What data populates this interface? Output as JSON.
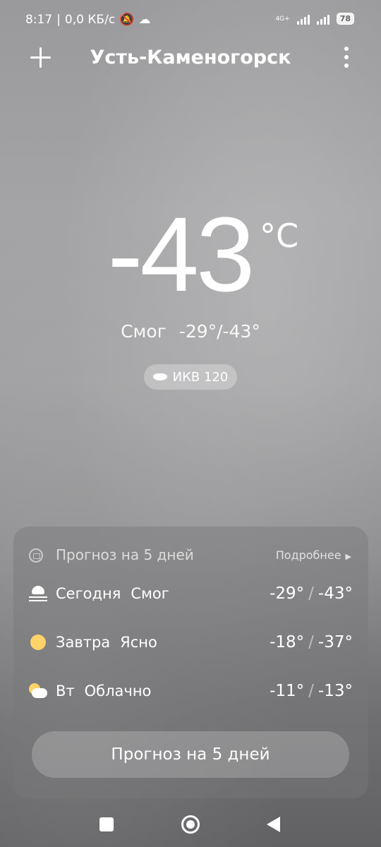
{
  "status_bar": {
    "time": "8:17",
    "speed": "0,0 КБ/с",
    "network": "4G+",
    "battery": "78"
  },
  "header": {
    "city": "Усть-Каменогорск"
  },
  "current": {
    "temperature": "-43",
    "unit": "°C",
    "condition": "Смог",
    "range": "-29°/-43°",
    "aqi_label": "ИКВ 120"
  },
  "forecast": {
    "title": "Прогноз на 5 дней",
    "more_label": "Подробнее",
    "days": [
      {
        "day": "Сегодня",
        "condition": "Смог",
        "icon": "smog-icon",
        "high": "-29°",
        "low": "-43°"
      },
      {
        "day": "Завтра",
        "condition": "Ясно",
        "icon": "sun-icon",
        "high": "-18°",
        "low": "-37°"
      },
      {
        "day": "Вт",
        "condition": "Облачно",
        "icon": "partly-cloudy-icon",
        "high": "-11°",
        "low": "-13°"
      }
    ],
    "button_label": "Прогноз на 5 дней"
  },
  "colors": {
    "sun": "#ffd369",
    "background_top": "#9a9a9c",
    "background_bottom": "#616163"
  }
}
